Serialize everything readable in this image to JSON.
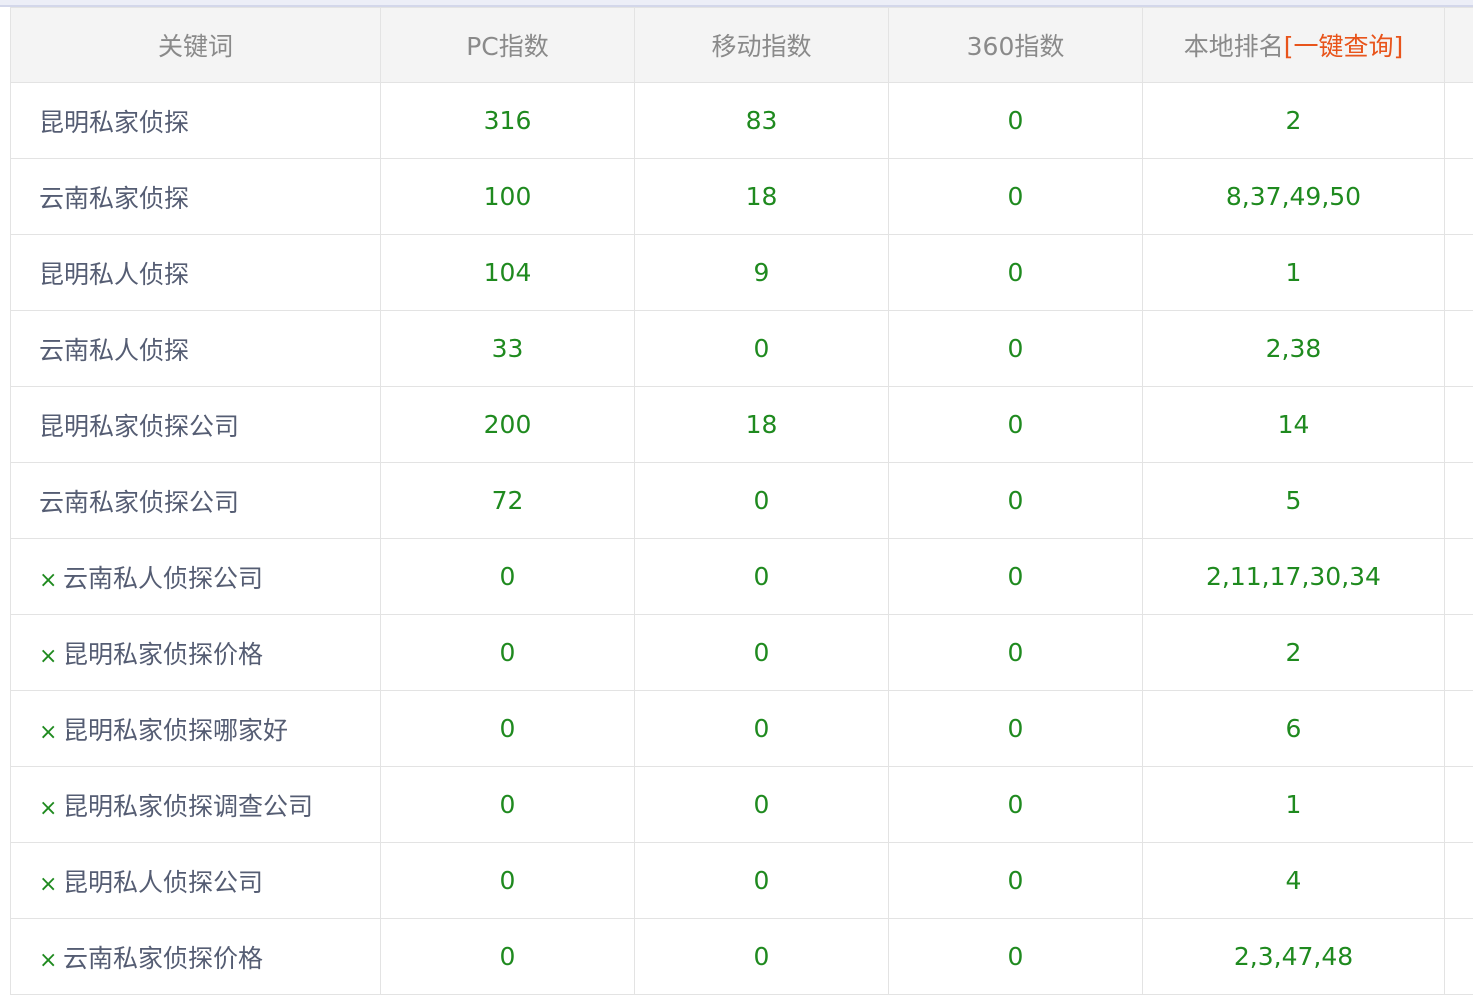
{
  "colors": {
    "header_bg": "#f4f4f4",
    "header_text": "#8a8a8a",
    "keyword_text": "#555d73",
    "value_text": "#1f8a1f",
    "link_text": "#e8541b",
    "border": "#e3e3e3"
  },
  "header": {
    "keyword": "关键词",
    "pc_index": "PC指数",
    "mobile_index": "移动指数",
    "index_360": "360指数",
    "local_rank": "本地排名",
    "query_all_link": "[一键查询]"
  },
  "rows": [
    {
      "keyword": "昆明私家侦探",
      "mark": "",
      "pc": "316",
      "mobile": "83",
      "i360": "0",
      "rank": "2"
    },
    {
      "keyword": "云南私家侦探",
      "mark": "",
      "pc": "100",
      "mobile": "18",
      "i360": "0",
      "rank": "8,37,49,50"
    },
    {
      "keyword": "昆明私人侦探",
      "mark": "",
      "pc": "104",
      "mobile": "9",
      "i360": "0",
      "rank": "1"
    },
    {
      "keyword": "云南私人侦探",
      "mark": "",
      "pc": "33",
      "mobile": "0",
      "i360": "0",
      "rank": "2,38"
    },
    {
      "keyword": "昆明私家侦探公司",
      "mark": "",
      "pc": "200",
      "mobile": "18",
      "i360": "0",
      "rank": "14"
    },
    {
      "keyword": "云南私家侦探公司",
      "mark": "",
      "pc": "72",
      "mobile": "0",
      "i360": "0",
      "rank": "5"
    },
    {
      "keyword": "云南私人侦探公司",
      "mark": "×",
      "pc": "0",
      "mobile": "0",
      "i360": "0",
      "rank": "2,11,17,30,34"
    },
    {
      "keyword": "昆明私家侦探价格",
      "mark": "×",
      "pc": "0",
      "mobile": "0",
      "i360": "0",
      "rank": "2"
    },
    {
      "keyword": "昆明私家侦探哪家好",
      "mark": "×",
      "pc": "0",
      "mobile": "0",
      "i360": "0",
      "rank": "6"
    },
    {
      "keyword": "昆明私家侦探调查公司",
      "mark": "×",
      "pc": "0",
      "mobile": "0",
      "i360": "0",
      "rank": "1"
    },
    {
      "keyword": "昆明私人侦探公司",
      "mark": "×",
      "pc": "0",
      "mobile": "0",
      "i360": "0",
      "rank": "4"
    },
    {
      "keyword": "云南私家侦探价格",
      "mark": "×",
      "pc": "0",
      "mobile": "0",
      "i360": "0",
      "rank": "2,3,47,48"
    }
  ]
}
